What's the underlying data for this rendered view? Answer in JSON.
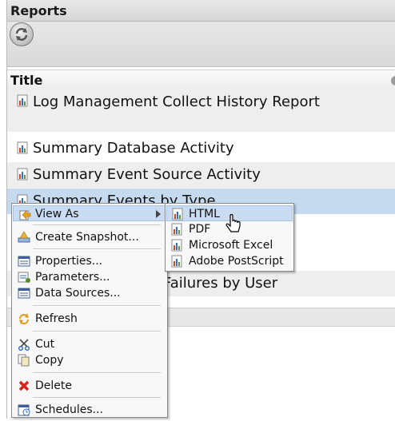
{
  "panel": {
    "title": "Reports"
  },
  "table": {
    "column_title": "Title",
    "rows": [
      {
        "title": "Log Management Collect History Report"
      },
      {
        "title": "Summary Database Activity"
      },
      {
        "title": "Summary Event Source Activity"
      },
      {
        "title": "Summary Events by Type"
      },
      {
        "title": "Failures by User"
      }
    ]
  },
  "context_menu": {
    "items": [
      {
        "label": "View As",
        "icon": "report-arrow-icon",
        "submenu": true
      },
      {
        "label": "Create Snapshot...",
        "icon": "snapshot-icon"
      },
      {
        "label": "Properties...",
        "icon": "properties-icon"
      },
      {
        "label": "Parameters...",
        "icon": "parameters-icon"
      },
      {
        "label": "Data Sources...",
        "icon": "data-sources-icon"
      },
      {
        "label": "Refresh",
        "icon": "refresh-icon"
      },
      {
        "label": "Cut",
        "icon": "scissors-icon"
      },
      {
        "label": "Copy",
        "icon": "copy-icon"
      },
      {
        "label": "Delete",
        "icon": "delete-x-icon"
      },
      {
        "label": "Schedules...",
        "icon": "schedules-icon"
      }
    ]
  },
  "submenu": {
    "items": [
      {
        "label": "HTML"
      },
      {
        "label": "PDF"
      },
      {
        "label": "Microsoft Excel"
      },
      {
        "label": "Adobe PostScript"
      }
    ]
  },
  "colors": {
    "selection": "#c6daef",
    "menu_hover": "#c9dcf2",
    "delete_red": "#d2261e",
    "icon_blue": "#2f66b8"
  }
}
